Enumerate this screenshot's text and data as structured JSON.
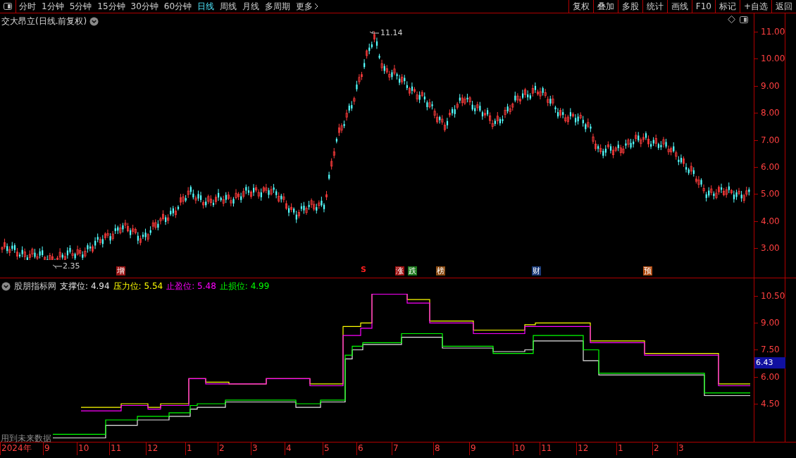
{
  "toolbar": {
    "periods": [
      {
        "label": "分时",
        "selected": false
      },
      {
        "label": "1分钟",
        "selected": false
      },
      {
        "label": "5分钟",
        "selected": false
      },
      {
        "label": "15分钟",
        "selected": false
      },
      {
        "label": "30分钟",
        "selected": false
      },
      {
        "label": "60分钟",
        "selected": false
      },
      {
        "label": "日线",
        "selected": true
      },
      {
        "label": "周线",
        "selected": false
      },
      {
        "label": "月线",
        "selected": false
      },
      {
        "label": "多周期",
        "selected": false
      }
    ],
    "more": "更多",
    "buttons": [
      "复权",
      "叠加",
      "多股",
      "统计",
      "画线",
      "F10",
      "标记",
      "+自选",
      "返回"
    ]
  },
  "chart": {
    "title": "交大昂立(日线.前复权)",
    "y_axis": [
      "11.00",
      "10.00",
      "9.00",
      "8.00",
      "7.00",
      "6.00",
      "5.00",
      "4.00",
      "3.00"
    ],
    "high_label": "11.14",
    "low_label": "2.35",
    "markers": [
      {
        "kind": "tag",
        "text": "增",
        "color": "#9b1414"
      },
      {
        "kind": "signal",
        "text": "S",
        "color": "#ff2020"
      },
      {
        "kind": "tag",
        "text": "涨",
        "color": "#a01010"
      },
      {
        "kind": "tag",
        "text": "跌",
        "color": "#1c7a1c"
      },
      {
        "kind": "tag",
        "text": "榜",
        "color": "#8a4a10"
      },
      {
        "kind": "tag",
        "text": "财",
        "color": "#1a3a78"
      },
      {
        "kind": "tag",
        "text": "预",
        "color": "#b04a10"
      }
    ]
  },
  "indicator": {
    "name": "股朋指标网",
    "items": [
      {
        "label": "支撑位:",
        "value": "4.94",
        "color": "#e6e6e6"
      },
      {
        "label": "压力位:",
        "value": "5.54",
        "color": "#ffff00"
      },
      {
        "label": "止盈位:",
        "value": "5.48",
        "color": "#ff00ff"
      },
      {
        "label": "止损位:",
        "value": "4.99",
        "color": "#00ff00"
      }
    ],
    "y_axis": [
      "10.50",
      "9.00",
      "7.50",
      "6.00",
      "4.50"
    ],
    "current_value": "6.43",
    "note": "用到未来数据"
  },
  "x_axis": [
    "2024年",
    "9",
    "10",
    "11",
    "12",
    "1",
    "2",
    "3",
    "4",
    "5",
    "6",
    "7",
    "8",
    "9",
    "10",
    "11",
    "12",
    "1",
    "2",
    "3"
  ]
}
